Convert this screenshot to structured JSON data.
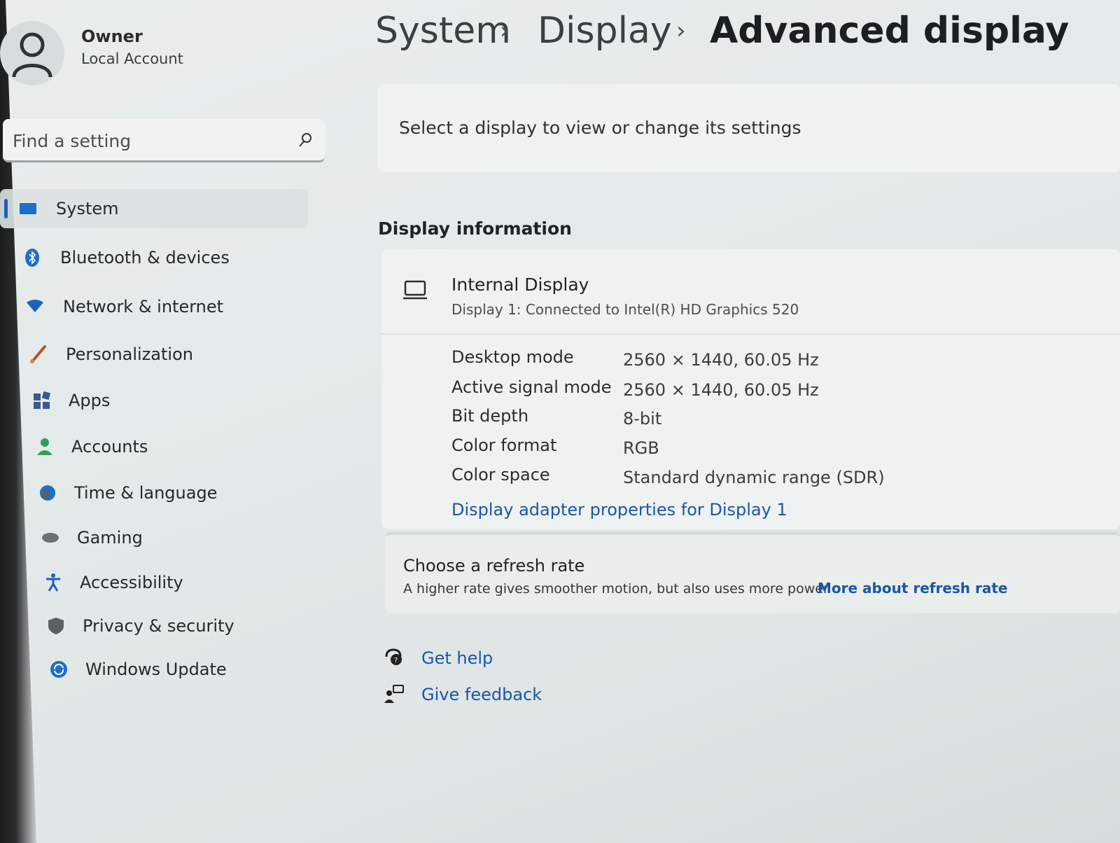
{
  "profile": {
    "name": "Owner",
    "account_type": "Local Account"
  },
  "search": {
    "placeholder": "Find a setting"
  },
  "sidebar": {
    "items": [
      {
        "label": "System",
        "icon": "monitor-icon",
        "active": true,
        "icon_color": "#1f6fc9"
      },
      {
        "label": "Bluetooth & devices",
        "icon": "bluetooth-icon",
        "icon_color": "#1f6fc9"
      },
      {
        "label": "Network & internet",
        "icon": "wifi-icon",
        "icon_color": "#1f5fbf"
      },
      {
        "label": "Personalization",
        "icon": "brush-icon",
        "icon_color": "#b0562c"
      },
      {
        "label": "Apps",
        "icon": "apps-icon",
        "icon_color": "#3d5a8a"
      },
      {
        "label": "Accounts",
        "icon": "person-icon",
        "icon_color": "#2e9e5b"
      },
      {
        "label": "Time & language",
        "icon": "globe-clock-icon",
        "icon_color": "#1f6fc9"
      },
      {
        "label": "Gaming",
        "icon": "gamepad-icon",
        "icon_color": "#6b7073"
      },
      {
        "label": "Accessibility",
        "icon": "accessibility-icon",
        "icon_color": "#1f5fbf"
      },
      {
        "label": "Privacy & security",
        "icon": "shield-icon",
        "icon_color": "#5b6063"
      },
      {
        "label": "Windows Update",
        "icon": "update-icon",
        "icon_color": "#1f6fc9"
      }
    ]
  },
  "breadcrumb": [
    "System",
    "Display",
    "Advanced display"
  ],
  "select_display": {
    "text": "Select a display to view or change its settings"
  },
  "display_info": {
    "section_title": "Display information",
    "display_name": "Internal Display",
    "display_sub": "Display 1: Connected to Intel(R) HD Graphics 520",
    "properties": [
      {
        "label": "Desktop mode",
        "value": "2560 × 1440, 60.05 Hz"
      },
      {
        "label": "Active signal mode",
        "value": "2560 × 1440, 60.05 Hz"
      },
      {
        "label": "Bit depth",
        "value": "8-bit"
      },
      {
        "label": "Color format",
        "value": "RGB"
      },
      {
        "label": "Color space",
        "value": "Standard dynamic range (SDR)"
      }
    ],
    "adapter_link": "Display adapter properties for Display 1"
  },
  "refresh": {
    "title": "Choose a refresh rate",
    "subtitle": "A higher rate gives smoother motion, but also uses more power",
    "link": "More about refresh rate"
  },
  "help": {
    "get_help": "Get help",
    "give_feedback": "Give feedback"
  },
  "colors": {
    "accent": "#1f5fbf",
    "link": "#1a56a8"
  }
}
